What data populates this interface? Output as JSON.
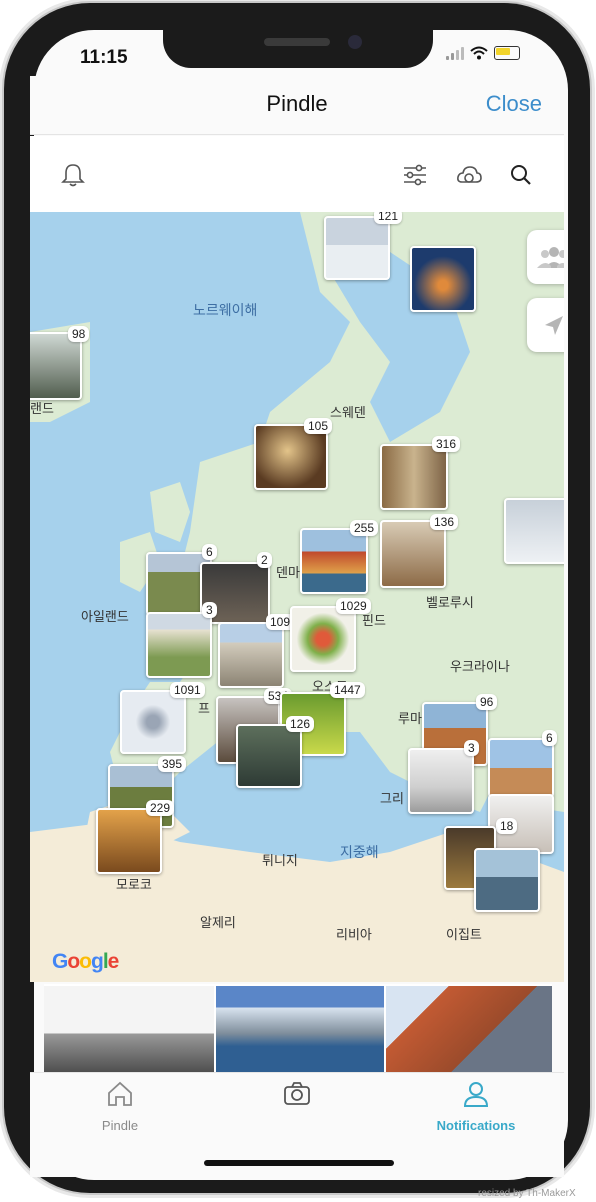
{
  "status_bar": {
    "time": "11:15"
  },
  "header": {
    "title": "Pindle",
    "close_label": "Close"
  },
  "toolbar": {
    "left_icon": "bell-icon",
    "right_icons": [
      "sliders-icon",
      "cloud-sync-icon",
      "search-icon"
    ]
  },
  "map": {
    "countries": [
      "스웨덴",
      "아일랜드",
      "벨로루시",
      "우크라이나",
      "모로코",
      "튀니지",
      "알제리",
      "리비아",
      "이집트",
      "그리",
      "루마",
      "프",
      "오스트",
      "핀드",
      "덴마",
      "랜드"
    ],
    "seas": [
      "노르웨이해",
      "지중해"
    ],
    "attribution": "Google",
    "cluster_counts": [
      "121",
      "98",
      "105",
      "316",
      "136",
      "255",
      "6",
      "2",
      "3",
      "1096",
      "1029",
      "1091",
      "534",
      "1447",
      "126",
      "96",
      "3",
      "6",
      "395",
      "229",
      "18"
    ]
  },
  "tabs": [
    {
      "label": "Pindle",
      "icon": "home-icon",
      "active": false
    },
    {
      "label": "",
      "icon": "camera-icon",
      "active": false
    },
    {
      "label": "Notifications",
      "icon": "person-icon",
      "active": true
    }
  ],
  "watermark": "resized by Th-MakerX",
  "colors": {
    "accent": "#3c8dcb",
    "active_tab": "#39a9c9",
    "sea": "#a6d1ec",
    "land": "#dcebd3"
  }
}
